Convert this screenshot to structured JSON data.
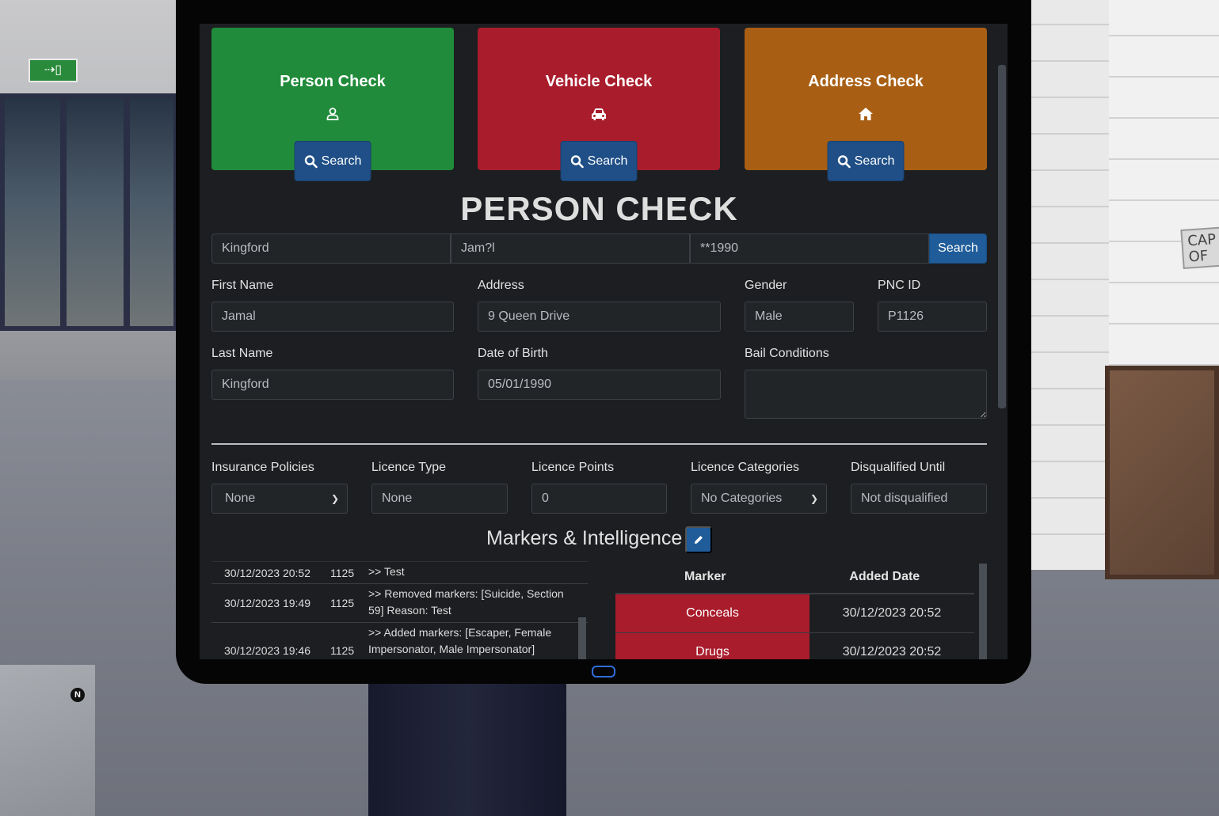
{
  "background": {
    "sign_text": "CAP OF",
    "compass": "N"
  },
  "cards": [
    {
      "title": "Person Check",
      "icon": "person-icon",
      "button_label": "Search",
      "color": "#208b3a"
    },
    {
      "title": "Vehicle Check",
      "icon": "car-icon",
      "button_label": "Search",
      "color": "#a91c2c"
    },
    {
      "title": "Address Check",
      "icon": "home-icon",
      "button_label": "Search",
      "color": "#a85f14"
    }
  ],
  "page_title": "PERSON CHECK",
  "search": {
    "last_name": "Kingford",
    "first_name": "Jam?l",
    "dob": "**1990",
    "button_label": "Search"
  },
  "person": {
    "first_name_label": "First Name",
    "first_name": "Jamal",
    "address_label": "Address",
    "address": "9 Queen Drive",
    "gender_label": "Gender",
    "gender": "Male",
    "pnc_label": "PNC ID",
    "pnc": "P1126",
    "last_name_label": "Last Name",
    "last_name": "Kingford",
    "dob_label": "Date of Birth",
    "dob": "05/01/1990",
    "bail_label": "Bail Conditions",
    "bail": ""
  },
  "licence": {
    "insurance_label": "Insurance Policies",
    "insurance": "None",
    "type_label": "Licence Type",
    "type": "None",
    "points_label": "Licence Points",
    "points": "0",
    "categories_label": "Licence Categories",
    "categories": "No Categories",
    "disqualified_label": "Disqualified Until",
    "disqualified": "Not disqualified"
  },
  "markers_title": "Markers & Intelligence",
  "log": [
    {
      "date": "30/12/2023 20:52",
      "user": "1125",
      "text": ">> Test"
    },
    {
      "date": "30/12/2023 19:49",
      "user": "1125",
      "text": ">> Removed markers: [Suicide, Section 59] Reason: Test"
    },
    {
      "date": "30/12/2023 19:46",
      "user": "1125",
      "text": ">> Added markers: [Escaper, Female Impersonator, Male Impersonator] Reason: Test"
    }
  ],
  "markers_table": {
    "header_marker": "Marker",
    "header_date": "Added Date",
    "rows": [
      {
        "marker": "Conceals",
        "date": "30/12/2023 20:52"
      },
      {
        "marker": "Drugs",
        "date": "30/12/2023 20:52"
      }
    ],
    "marker_color": "#a91c2c"
  },
  "accent": "#1f5c99"
}
